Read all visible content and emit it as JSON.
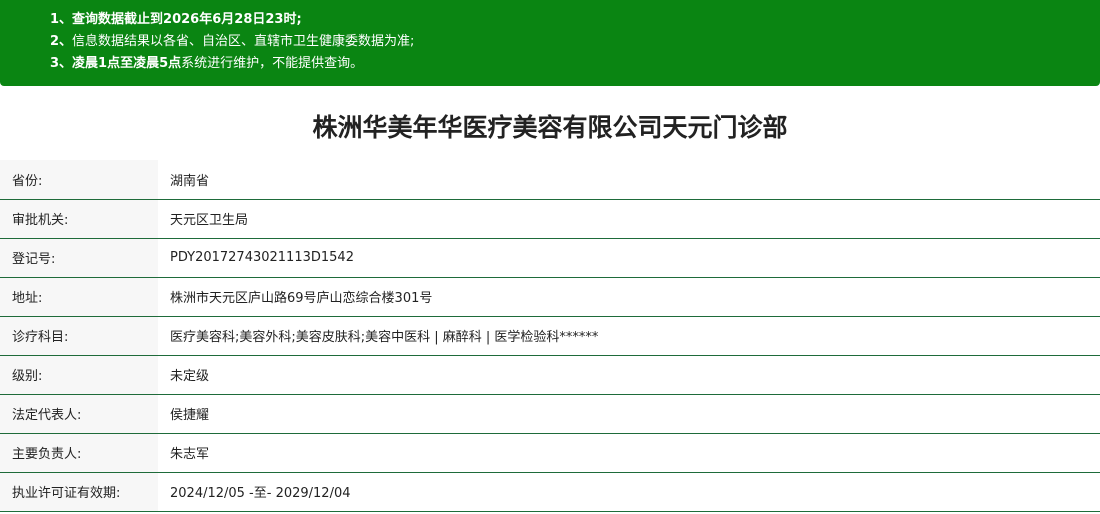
{
  "notice": {
    "line1": {
      "num": "1、",
      "text": "查询数据截止到2026年6月28日23时;"
    },
    "line2": {
      "num": "2、",
      "text": "信息数据结果以各省、自治区、直辖市卫生健康委数据为准;"
    },
    "line3": {
      "num": "3、",
      "bold": "凌晨1点至凌晨5点",
      "rest": "系统进行维护，不能提供查询。"
    }
  },
  "title": "株洲华美年华医疗美容有限公司天元门诊部",
  "rows": [
    {
      "label": "省份:",
      "value": "湖南省"
    },
    {
      "label": "审批机关:",
      "value": "天元区卫生局"
    },
    {
      "label": "登记号:",
      "value": "PDY20172743021113D1542"
    },
    {
      "label": "地址:",
      "value": "株洲市天元区庐山路69号庐山恋综合楼301号"
    },
    {
      "label": "诊疗科目:",
      "value": "医疗美容科;美容外科;美容皮肤科;美容中医科 | 麻醉科 | 医学检验科******"
    },
    {
      "label": "级别:",
      "value": "未定级"
    },
    {
      "label": "法定代表人:",
      "value": "侯捷耀"
    },
    {
      "label": "主要负责人:",
      "value": "朱志军"
    },
    {
      "label": "执业许可证有效期:",
      "value": "2024/12/05 -至- 2029/12/04"
    }
  ],
  "colors": {
    "notice_bg": "#0a8512",
    "row_border": "#1e6b3a",
    "label_bg": "#f7f7f7"
  }
}
